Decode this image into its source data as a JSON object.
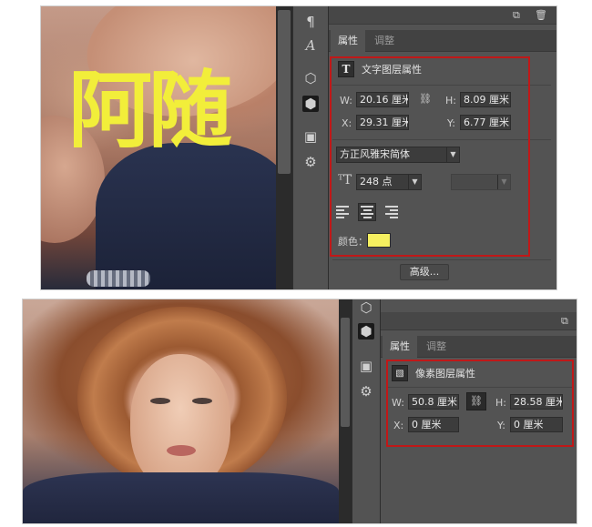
{
  "screen1": {
    "overlay_text": "阿随",
    "tools": [
      {
        "icon": "paragraph-icon",
        "glyph": "¶"
      },
      {
        "icon": "character-icon",
        "glyph": "A"
      },
      {
        "icon": "3d-cube-icon",
        "glyph": "⬡"
      },
      {
        "icon": "3d-cube-selected-icon",
        "glyph": "⬢"
      },
      {
        "icon": "image-icon",
        "glyph": "▣"
      },
      {
        "icon": "adjust-icon",
        "glyph": "⚙"
      }
    ],
    "panel": {
      "tabs": [
        {
          "label": "属性",
          "active": true
        },
        {
          "label": "调整",
          "active": false
        }
      ],
      "section_title": "文字图层属性",
      "w_label": "W:",
      "w_value": "20.16 厘米",
      "h_label": "H:",
      "h_value": "8.09 厘米",
      "x_label": "X:",
      "x_value": "29.31 厘米",
      "y_label": "Y:",
      "y_value": "6.77 厘米",
      "font_family": "方正风雅宋简体",
      "font_size": "248 点",
      "color_label": "颜色：",
      "color_value": "#f6f060",
      "advanced_button": "高级..."
    }
  },
  "screen2": {
    "tools": [
      {
        "icon": "3d-cube-icon",
        "glyph": "⬡"
      },
      {
        "icon": "3d-cube-selected-icon",
        "glyph": "⬢"
      },
      {
        "icon": "image-icon",
        "glyph": "▣"
      },
      {
        "icon": "adjust-icon",
        "glyph": "⚙"
      }
    ],
    "panel": {
      "tabs": [
        {
          "label": "属性",
          "active": true
        },
        {
          "label": "调整",
          "active": false
        }
      ],
      "section_title": "像素图层属性",
      "w_label": "W:",
      "w_value": "50.8 厘米",
      "h_label": "H:",
      "h_value": "28.58 厘米",
      "x_label": "X:",
      "x_value": "0 厘米",
      "y_label": "Y:",
      "y_value": "0 厘米"
    }
  },
  "colors": {
    "panel_bg": "#535353",
    "highlight_border": "#c01818",
    "text_color_yellow": "#f2ee3a"
  }
}
